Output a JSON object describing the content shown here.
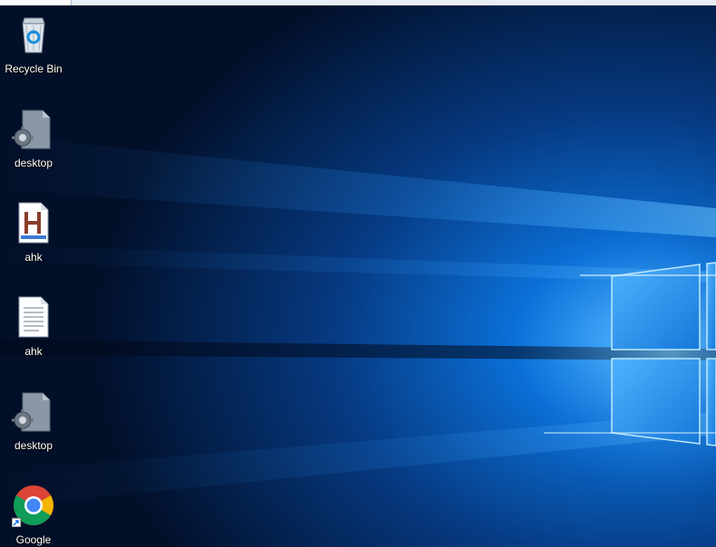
{
  "desktop": {
    "icons": [
      {
        "label": "Recycle Bin",
        "icon": "recycle-bin-icon"
      },
      {
        "label": "desktop",
        "icon": "settings-file-icon"
      },
      {
        "label": "ahk",
        "icon": "autohotkey-script-icon"
      },
      {
        "label": "ahk",
        "icon": "text-file-icon"
      },
      {
        "label": "desktop",
        "icon": "settings-file-icon"
      },
      {
        "label": "Google\nChrome",
        "icon": "chrome-icon"
      }
    ]
  },
  "colors": {
    "wallpaper_dark": "#031a3d",
    "wallpaper_light": "#1f8ef0",
    "label_text": "#ffffff"
  }
}
